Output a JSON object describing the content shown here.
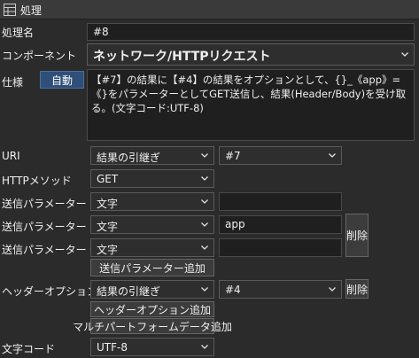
{
  "header": {
    "title": "処理"
  },
  "rows": {
    "name": {
      "label": "処理名",
      "value": "#8"
    },
    "component": {
      "label": "コンポーネント",
      "value": "ネットワーク/HTTPリクエスト"
    },
    "spec": {
      "label": "仕様",
      "auto_button": "自動",
      "text": "【#7】の結果に【#4】の結果をオプションとして、{}_《app》=《}をパラメーターとしてGET送信し、結果(Header/Body)を受け取る。(文字コード:UTF-8)"
    },
    "uri": {
      "label": "URI",
      "source": "結果の引継ぎ",
      "value": "#7"
    },
    "method": {
      "label": "HTTPメソッド",
      "value": "GET"
    },
    "param": {
      "label": "送信パラメーター",
      "type": "文字",
      "value": ""
    },
    "param_key": {
      "label": "送信パラメーター キー",
      "type": "文字",
      "value": "app"
    },
    "param_value": {
      "label": "送信パラメーター 値",
      "type": "文字",
      "value": ""
    },
    "delete_label": "削除",
    "add_param": "送信パラメーター追加",
    "header_option": {
      "label": "ヘッダーオプション",
      "source": "結果の引継ぎ",
      "value": "#4"
    },
    "add_header": "ヘッダーオプション追加",
    "add_multipart": "マルチパートフォームデータ追加",
    "charset": {
      "label": "文字コード",
      "value": "UTF-8"
    }
  }
}
